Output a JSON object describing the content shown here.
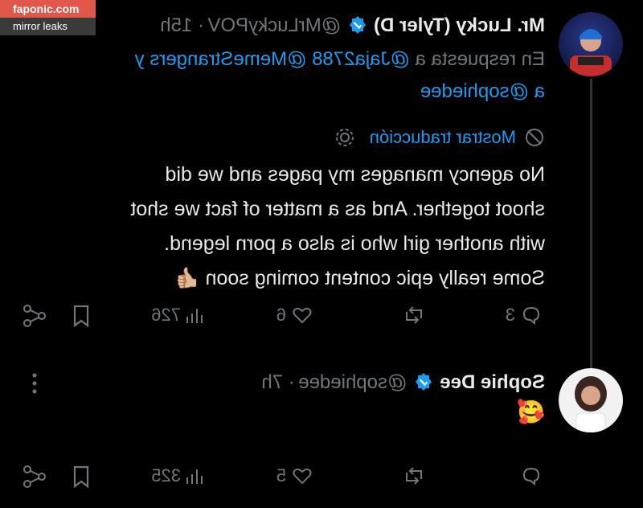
{
  "watermark": {
    "site": "faponic.com",
    "subtitle": "mirror leaks"
  },
  "tweet1": {
    "author_name": "Mr. Lucky (Tyler D)",
    "handle": "@MrLuckyPOV",
    "time_fragment": "· 15h",
    "reply_prefix": "En respuesta a",
    "reply_users": "@Jaja2788 @MemeStrangers y",
    "reply_users_2": "a @sophiedee",
    "translate_label": "Mostrar traducción",
    "body_lines": [
      "No agency manages my  pages and we did",
      "shoot together. And as a matter of fact we shot",
      "with another girl who is also a porn legend.",
      "Some really epic content coming soon 👍🏼"
    ],
    "replies": "3",
    "likes": "6",
    "views": "726"
  },
  "tweet2": {
    "author_name": "Sophie Dee",
    "handle": "@sophiedee",
    "time": "· 7h",
    "body": "🥰",
    "likes": "5",
    "views": "325"
  },
  "colors": {
    "accent": "#1d9bf0",
    "muted": "#71767b",
    "text": "#e7e9ea",
    "background": "#000000"
  }
}
